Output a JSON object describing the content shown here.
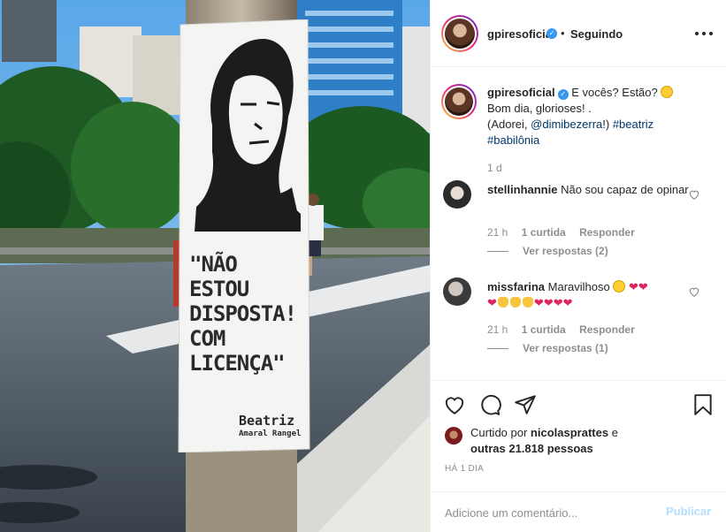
{
  "post": {
    "image_alt": "",
    "poster": {
      "lines": [
        "\"NÃO",
        "ESTOU",
        "DISPOSTA!",
        "COM",
        "LICENÇA\""
      ],
      "signature": "Beatriz",
      "signature_sub": "Amaral Rangel"
    }
  },
  "header": {
    "username": "gpiresoficial",
    "verified_icon": "verified-badge",
    "separator": "•",
    "follow_status": "Seguindo",
    "more_icon": "more-options-icon"
  },
  "caption": {
    "username": "gpiresoficial",
    "text_part1": " E vocês? Estão? ",
    "text_part2": "Bom dia, glorioses! .",
    "text_part3": "(Adorei, ",
    "mention": "@dimibezerra",
    "text_part4": "!) ",
    "hashtag1": "#beatriz",
    "hashtag2": "#babilônia",
    "time": "1 d"
  },
  "comments": [
    {
      "username": "stellinhannie",
      "text": " Não sou capaz de opinar",
      "time": "21 h",
      "likes": "1 curtida",
      "reply": "Responder",
      "replies": "Ver respostas (2)"
    },
    {
      "username": "missfarina",
      "text": " Maravilhoso ",
      "time": "21 h",
      "likes": "1 curtida",
      "reply": "Responder",
      "replies": "Ver respostas (1)"
    }
  ],
  "actions": {
    "like_icon": "heart-icon",
    "comment_icon": "comment-icon",
    "share_icon": "share-icon",
    "save_icon": "bookmark-icon"
  },
  "likes": {
    "prefix": "Curtido por ",
    "user": "nicolasprattes",
    "middle": " e",
    "others": "outras 21.818 pessoas"
  },
  "posted_ago": "HÁ 1 DIA",
  "add_comment": {
    "placeholder": "Adicione um comentário...",
    "post_label": "Publicar"
  },
  "colors": {
    "accent": "#3897f0",
    "link": "#00376b",
    "muted": "#8e8e8e",
    "post_disabled": "#b2dffc"
  }
}
